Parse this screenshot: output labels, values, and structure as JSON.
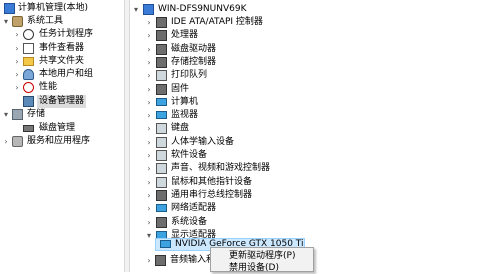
{
  "left_tree": [
    {
      "label": "计算机管理(本地)",
      "icon": "computer-management-icon",
      "arrow": ""
    },
    {
      "label": "系统工具",
      "icon": "system-tools-icon",
      "arrow": "▾"
    },
    {
      "label": "任务计划程序",
      "icon": "task-scheduler-icon",
      "arrow": "›"
    },
    {
      "label": "事件查看器",
      "icon": "event-viewer-icon",
      "arrow": "›"
    },
    {
      "label": "共享文件夹",
      "icon": "shared-folders-icon",
      "arrow": "›"
    },
    {
      "label": "本地用户和组",
      "icon": "local-users-icon",
      "arrow": "›"
    },
    {
      "label": "性能",
      "icon": "performance-icon",
      "arrow": "›"
    },
    {
      "label": "设备管理器",
      "icon": "device-manager-icon",
      "arrow": ""
    },
    {
      "label": "存储",
      "icon": "storage-icon",
      "arrow": "▾"
    },
    {
      "label": "磁盘管理",
      "icon": "disk-management-icon",
      "arrow": ""
    },
    {
      "label": "服务和应用程序",
      "icon": "services-apps-icon",
      "arrow": "›"
    }
  ],
  "device_tree": {
    "root": "WIN-DFS9NUNV69K",
    "categories": [
      {
        "label": "IDE ATA/ATAPI 控制器",
        "icon": "ide-controller-icon"
      },
      {
        "label": "处理器",
        "icon": "processor-icon"
      },
      {
        "label": "磁盘驱动器",
        "icon": "disk-drive-icon"
      },
      {
        "label": "存储控制器",
        "icon": "storage-controller-icon"
      },
      {
        "label": "打印队列",
        "icon": "print-queue-icon"
      },
      {
        "label": "固件",
        "icon": "firmware-icon"
      },
      {
        "label": "计算机",
        "icon": "computer-icon"
      },
      {
        "label": "监视器",
        "icon": "monitor-icon"
      },
      {
        "label": "键盘",
        "icon": "keyboard-icon"
      },
      {
        "label": "人体学输入设备",
        "icon": "hid-icon"
      },
      {
        "label": "软件设备",
        "icon": "software-device-icon"
      },
      {
        "label": "声音、视频和游戏控制器",
        "icon": "sound-icon"
      },
      {
        "label": "鼠标和其他指针设备",
        "icon": "mouse-icon"
      },
      {
        "label": "通用串行总线控制器",
        "icon": "usb-icon"
      },
      {
        "label": "网络适配器",
        "icon": "network-adapter-icon"
      },
      {
        "label": "系统设备",
        "icon": "system-device-icon"
      },
      {
        "label": "显示适配器",
        "icon": "display-adapter-icon"
      }
    ],
    "display_child": "NVIDIA GeForce GTX 1050 Ti",
    "after": "音频输入和"
  },
  "context_menu": {
    "items": [
      "更新驱动程序(P)",
      "禁用设备(D)"
    ]
  },
  "colors": {
    "selection": "#cce8ff",
    "selection_border": "#99d1ff",
    "left_selected": "#dcdcdc",
    "splitter": "#f2f2f2"
  }
}
